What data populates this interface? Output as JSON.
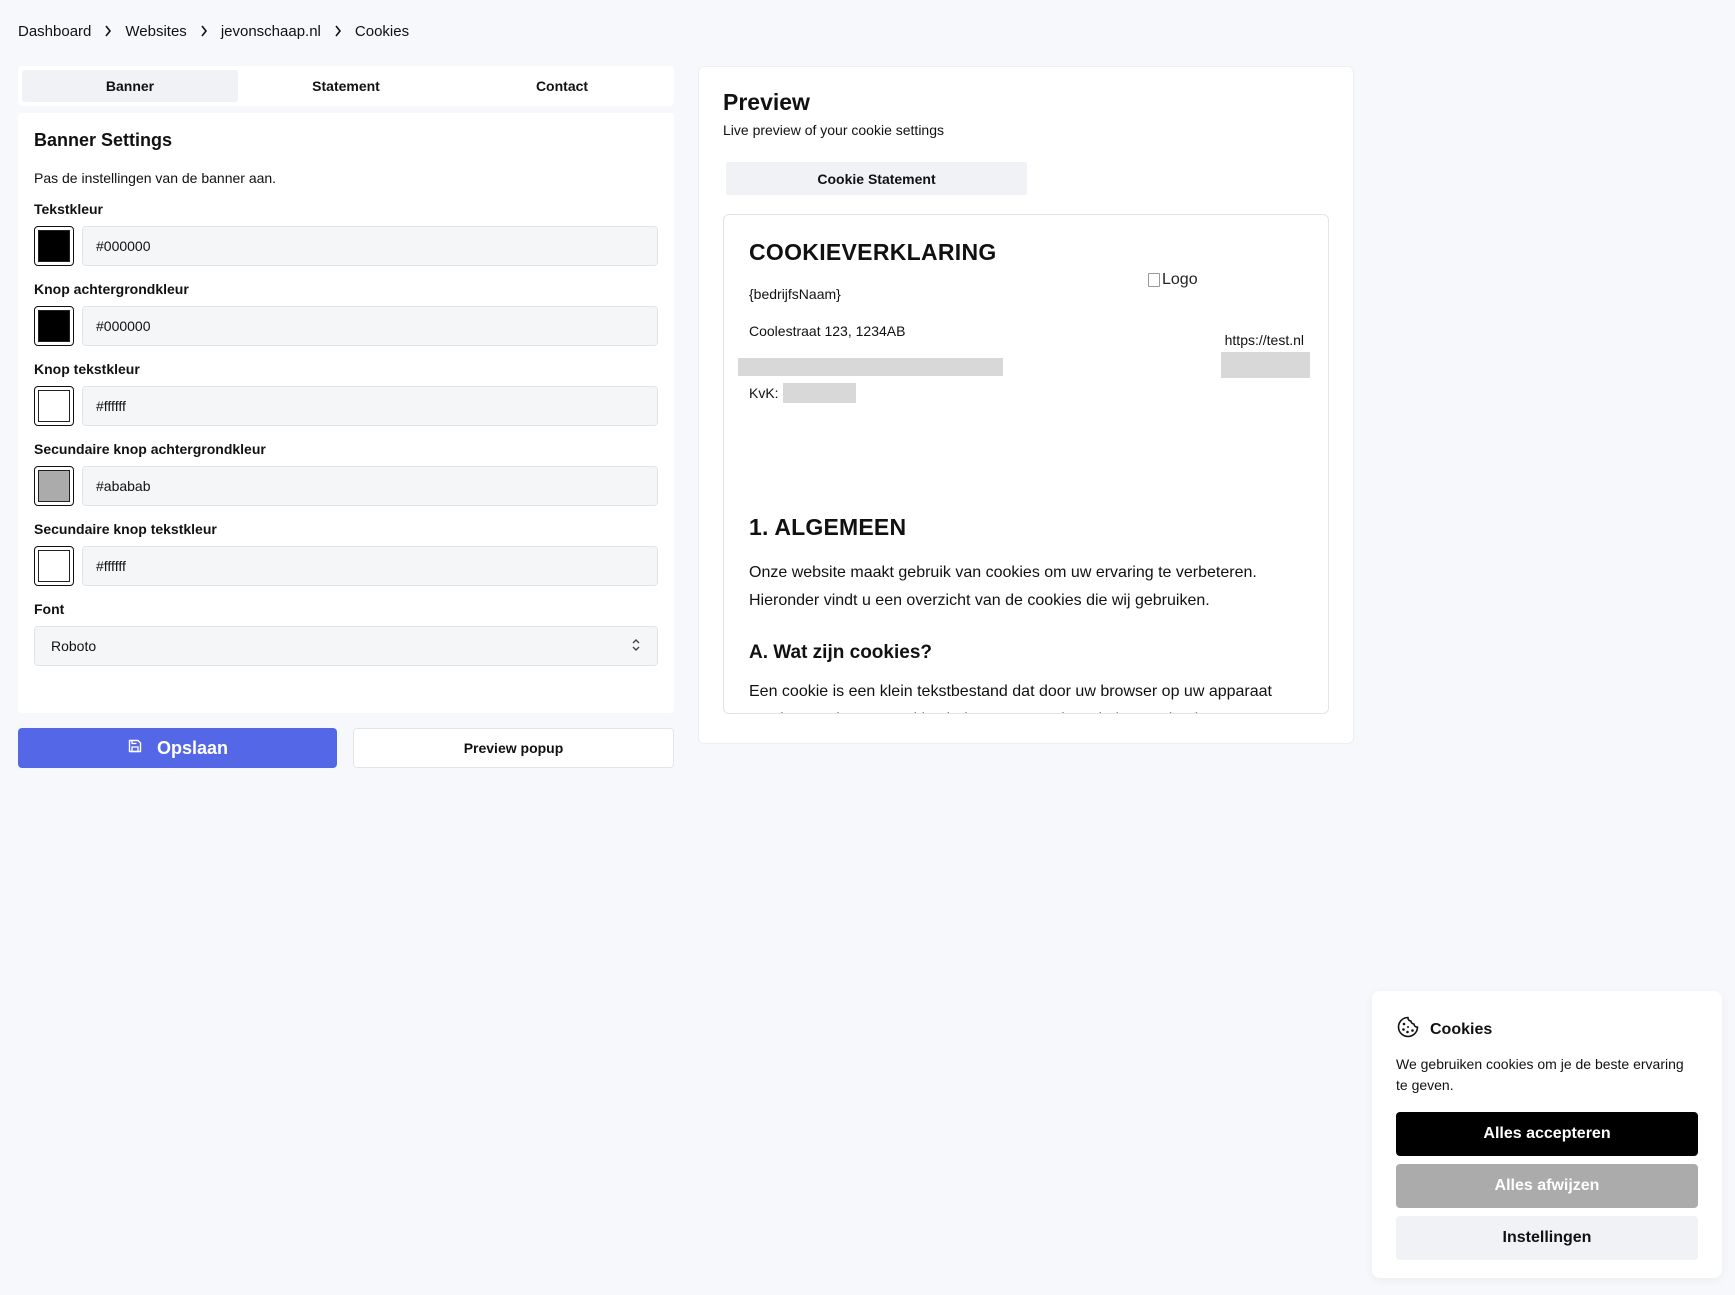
{
  "breadcrumb": {
    "items": [
      "Dashboard",
      "Websites",
      "jevonschaap.nl",
      "Cookies"
    ]
  },
  "tabs": {
    "banner": "Banner",
    "statement": "Statement",
    "contact": "Contact",
    "active": "Banner"
  },
  "settings": {
    "title": "Banner Settings",
    "description": "Pas de instellingen van de banner aan.",
    "fields": [
      {
        "label": "Tekstkleur",
        "value": "#000000",
        "color": "#000000"
      },
      {
        "label": "Knop achtergrondkleur",
        "value": "#000000",
        "color": "#000000"
      },
      {
        "label": "Knop tekstkleur",
        "value": "#ffffff",
        "color": "#ffffff"
      },
      {
        "label": "Secundaire knop achtergrondkleur",
        "value": "#ababab",
        "color": "#ababab"
      },
      {
        "label": "Secundaire knop tekstkleur",
        "value": "#ffffff",
        "color": "#ffffff"
      }
    ],
    "font": {
      "label": "Font",
      "value": "Roboto"
    }
  },
  "actions": {
    "save_label": "Opslaan",
    "preview_label": "Preview popup",
    "save_color": "#5468e7"
  },
  "preview": {
    "title": "Preview",
    "subtitle": "Live preview of your cookie settings",
    "tab_label": "Cookie Statement",
    "statement": {
      "heading": "COOKIEVERKLARING",
      "logo_alt": "Logo",
      "company": "{bedrijfsNaam}",
      "address": "Coolestraat 123, 1234AB",
      "kvk_label": "KvK:",
      "url": "https://test.nl",
      "section1_title": "1. ALGEMEEN",
      "section1_text": "Onze website maakt gebruik van cookies om uw ervaring te verbeteren. Hieronder vindt u een overzicht van de cookies die wij gebruiken.",
      "section_a_title": "A. Wat zijn cookies?",
      "section_a_text": "Een cookie is een klein tekstbestand dat door uw browser op uw apparaat wordt opgeslagen. Cookies helpen ons om de website goed te laten functioneren en om uw voorkeuren te onthouden."
    }
  },
  "cookie_banner": {
    "title": "Cookies",
    "text": "We gebruiken cookies om je de beste ervaring te geven.",
    "accept_label": "Alles accepteren",
    "reject_label": "Alles afwijzen",
    "settings_label": "Instellingen",
    "accept_bg": "#000000",
    "accept_fg": "#ffffff",
    "reject_bg": "#ababab",
    "reject_fg": "#ffffff",
    "settings_bg": "#f1f2f5",
    "settings_fg": "#111111"
  }
}
